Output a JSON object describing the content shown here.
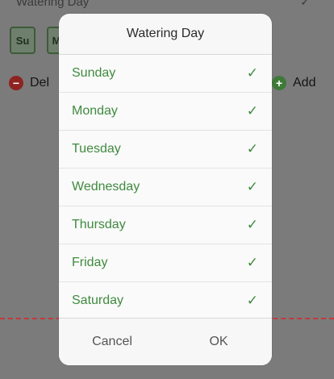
{
  "background": {
    "header_label": "Watering Day",
    "chips": [
      "Su",
      "M"
    ],
    "delete_label": "Del",
    "add_label": "Add"
  },
  "dialog": {
    "title": "Watering Day",
    "options": [
      {
        "label": "Sunday",
        "checked": true
      },
      {
        "label": "Monday",
        "checked": true
      },
      {
        "label": "Tuesday",
        "checked": true
      },
      {
        "label": "Wednesday",
        "checked": true
      },
      {
        "label": "Thursday",
        "checked": true
      },
      {
        "label": "Friday",
        "checked": true
      },
      {
        "label": "Saturday",
        "checked": true
      }
    ],
    "cancel_label": "Cancel",
    "ok_label": "OK"
  },
  "colors": {
    "accent_green": "#3f8a3f",
    "delete_red": "#8e2420",
    "guide_line": "#c23a3a"
  }
}
